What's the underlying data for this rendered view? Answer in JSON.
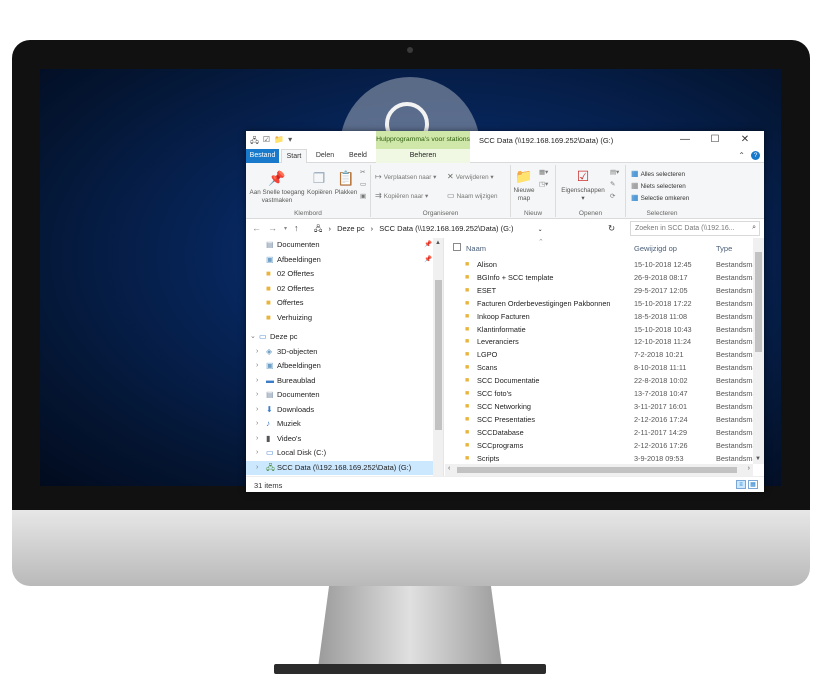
{
  "window": {
    "title": "SCC Data (\\\\192.168.169.252\\Data) (G:)",
    "context_tab": "Hulpprogramma's voor stations",
    "controls": [
      "—",
      "☐",
      "✕"
    ]
  },
  "ribbon_tabs": {
    "file": "Bestand",
    "start": "Start",
    "share": "Delen",
    "view": "Beeld",
    "manage": "Beheren"
  },
  "ribbon": {
    "clipboard": {
      "pin": "Aan Snelle toegang vastmaken",
      "copy": "Kopiëren",
      "paste": "Plakken",
      "label": "Klembord"
    },
    "organize": {
      "move": "Verplaatsen naar",
      "copy_to": "Kopiëren naar",
      "delete": "Verwijderen",
      "rename": "Naam wijzigen",
      "label": "Organiseren"
    },
    "new": {
      "folder": "Nieuwe map",
      "label": "Nieuw"
    },
    "open": {
      "properties": "Eigenschappen",
      "label": "Openen"
    },
    "select": {
      "all": "Alles selecteren",
      "none": "Niets selecteren",
      "invert": "Selectie omkeren",
      "label": "Selecteren"
    }
  },
  "address": {
    "crumbs": [
      "Deze pc",
      "SCC Data (\\\\192.168.169.252\\Data) (G:)"
    ],
    "search_placeholder": "Zoeken in SCC Data (\\\\192.16..."
  },
  "nav_pane": {
    "quick_access": [
      {
        "label": "Documenten",
        "pinned": true
      },
      {
        "label": "Afbeeldingen",
        "pinned": true
      },
      {
        "label": "02 Offertes",
        "pinned": false
      },
      {
        "label": "02 Offertes",
        "pinned": false
      },
      {
        "label": "Offertes",
        "pinned": false
      },
      {
        "label": "Verhuizing",
        "pinned": false
      }
    ],
    "this_pc": "Deze pc",
    "pc_items": [
      "3D-objecten",
      "Afbeeldingen",
      "Bureaublad",
      "Documenten",
      "Downloads",
      "Muziek",
      "Video's",
      "Local Disk (C:)",
      "SCC Data (\\\\192.168.169.252\\Data) (G:)"
    ]
  },
  "columns": {
    "name": "Naam",
    "modified": "Gewijzigd op",
    "type": "Type"
  },
  "files": [
    {
      "name": "Alison",
      "modified": "15-10-2018 12:45",
      "type": "Bestandsmap"
    },
    {
      "name": "BGInfo + SCC template",
      "modified": "26-9-2018 08:17",
      "type": "Bestandsmap"
    },
    {
      "name": "ESET",
      "modified": "29-5-2017 12:05",
      "type": "Bestandsmap"
    },
    {
      "name": "Facturen Orderbevestigingen Pakbonnen",
      "modified": "15-10-2018 17:22",
      "type": "Bestandsmap"
    },
    {
      "name": "Inkoop Facturen",
      "modified": "18-5-2018 11:08",
      "type": "Bestandsmap"
    },
    {
      "name": "Klantinformatie",
      "modified": "15-10-2018 10:43",
      "type": "Bestandsmap"
    },
    {
      "name": "Leveranciers",
      "modified": "12-10-2018 11:24",
      "type": "Bestandsmap"
    },
    {
      "name": "LGPO",
      "modified": "7-2-2018 10:21",
      "type": "Bestandsmap"
    },
    {
      "name": "Scans",
      "modified": "8-10-2018 11:11",
      "type": "Bestandsmap"
    },
    {
      "name": "SCC Documentatie",
      "modified": "22-8-2018 10:02",
      "type": "Bestandsmap"
    },
    {
      "name": "SCC foto's",
      "modified": "13-7-2018 10:47",
      "type": "Bestandsmap"
    },
    {
      "name": "SCC Networking",
      "modified": "3-11-2017 16:01",
      "type": "Bestandsmap"
    },
    {
      "name": "SCC Presentaties",
      "modified": "2-12-2016 17:24",
      "type": "Bestandsmap"
    },
    {
      "name": "SCCDatabase",
      "modified": "2-11-2017 14:29",
      "type": "Bestandsmap"
    },
    {
      "name": "SCCprograms",
      "modified": "2-12-2016 17:26",
      "type": "Bestandsmap"
    },
    {
      "name": "Scripts",
      "modified": "3-9-2018 09:53",
      "type": "Bestandsmap"
    }
  ],
  "status": {
    "count": "31 items"
  }
}
